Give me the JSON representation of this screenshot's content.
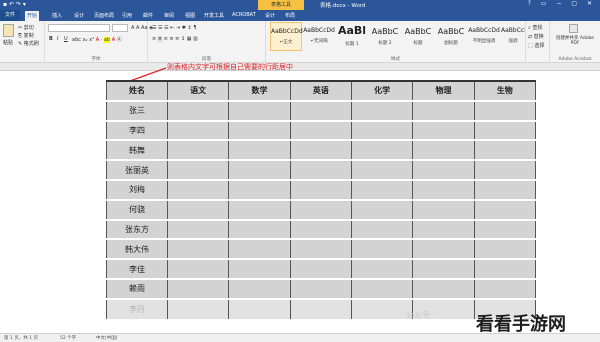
{
  "titlebar": {
    "context_tab": "表格工具",
    "title": "表格.docx - Word"
  },
  "tabs": [
    "文件",
    "开始",
    "插入",
    "设计",
    "页面布局",
    "引用",
    "邮件",
    "审阅",
    "视图",
    "开发工具",
    "ACROBAT",
    "设计",
    "布局"
  ],
  "ribbon": {
    "clipboard": {
      "paste": "粘贴",
      "cut": "剪切",
      "copy": "复制",
      "format_painter": "格式刷"
    },
    "font": {
      "name": "",
      "size": "",
      "bold": "B",
      "italic": "I",
      "underline": "U",
      "label": "字体"
    },
    "paragraph": {
      "label": "段落"
    },
    "styles": {
      "label": "样式",
      "items": [
        {
          "sample": "AaBbCcDd",
          "name": "↵正文"
        },
        {
          "sample": "AaBbCcDd",
          "name": "↵无间隔"
        },
        {
          "sample": "AaBl",
          "name": "标题 1"
        },
        {
          "sample": "AaBbC",
          "name": "标题 2"
        },
        {
          "sample": "AaBbC",
          "name": "标题"
        },
        {
          "sample": "AaBbC",
          "name": "副标题"
        },
        {
          "sample": "AaBbCcDd",
          "name": "不明显强调"
        },
        {
          "sample": "AaBbCcDd",
          "name": "强调"
        }
      ]
    },
    "editing": {
      "find": "查找",
      "replace": "替换",
      "select": "选择"
    },
    "adobe": {
      "create_pdf": "创建并共享 Adobe PDF",
      "group_label": "Adobe Acrobat"
    }
  },
  "annotation": "则表格内文字可根据自己需要的行距居中",
  "table": {
    "headers": [
      "姓名",
      "语文",
      "数学",
      "英语",
      "化学",
      "物理",
      "生物"
    ],
    "rows": [
      [
        "张三",
        "",
        "",
        "",
        "",
        "",
        ""
      ],
      [
        "李四",
        "",
        "",
        "",
        "",
        "",
        ""
      ],
      [
        "韩舞",
        "",
        "",
        "",
        "",
        "",
        ""
      ],
      [
        "张丽英",
        "",
        "",
        "",
        "",
        "",
        ""
      ],
      [
        "刘梅",
        "",
        "",
        "",
        "",
        "",
        ""
      ],
      [
        "何骁",
        "",
        "",
        "",
        "",
        "",
        ""
      ],
      [
        "张东方",
        "",
        "",
        "",
        "",
        "",
        ""
      ],
      [
        "韩大伟",
        "",
        "",
        "",
        "",
        "",
        ""
      ],
      [
        "李佳",
        "",
        "",
        "",
        "",
        "",
        ""
      ],
      [
        "赖雨",
        "",
        "",
        "",
        "",
        "",
        ""
      ],
      [
        "李丹",
        "",
        "",
        "",
        "",
        "",
        ""
      ]
    ]
  },
  "status": {
    "page": "第 1 页，共 1 页",
    "words": "52 个字",
    "lang": "中文(中国)"
  },
  "watermark": {
    "source": "公众号 ·",
    "brand": "看看手游网"
  },
  "colors": {
    "word_blue": "#2b579a",
    "annotation_red": "#d9262b",
    "cell_shading": "#d3d3d3"
  }
}
